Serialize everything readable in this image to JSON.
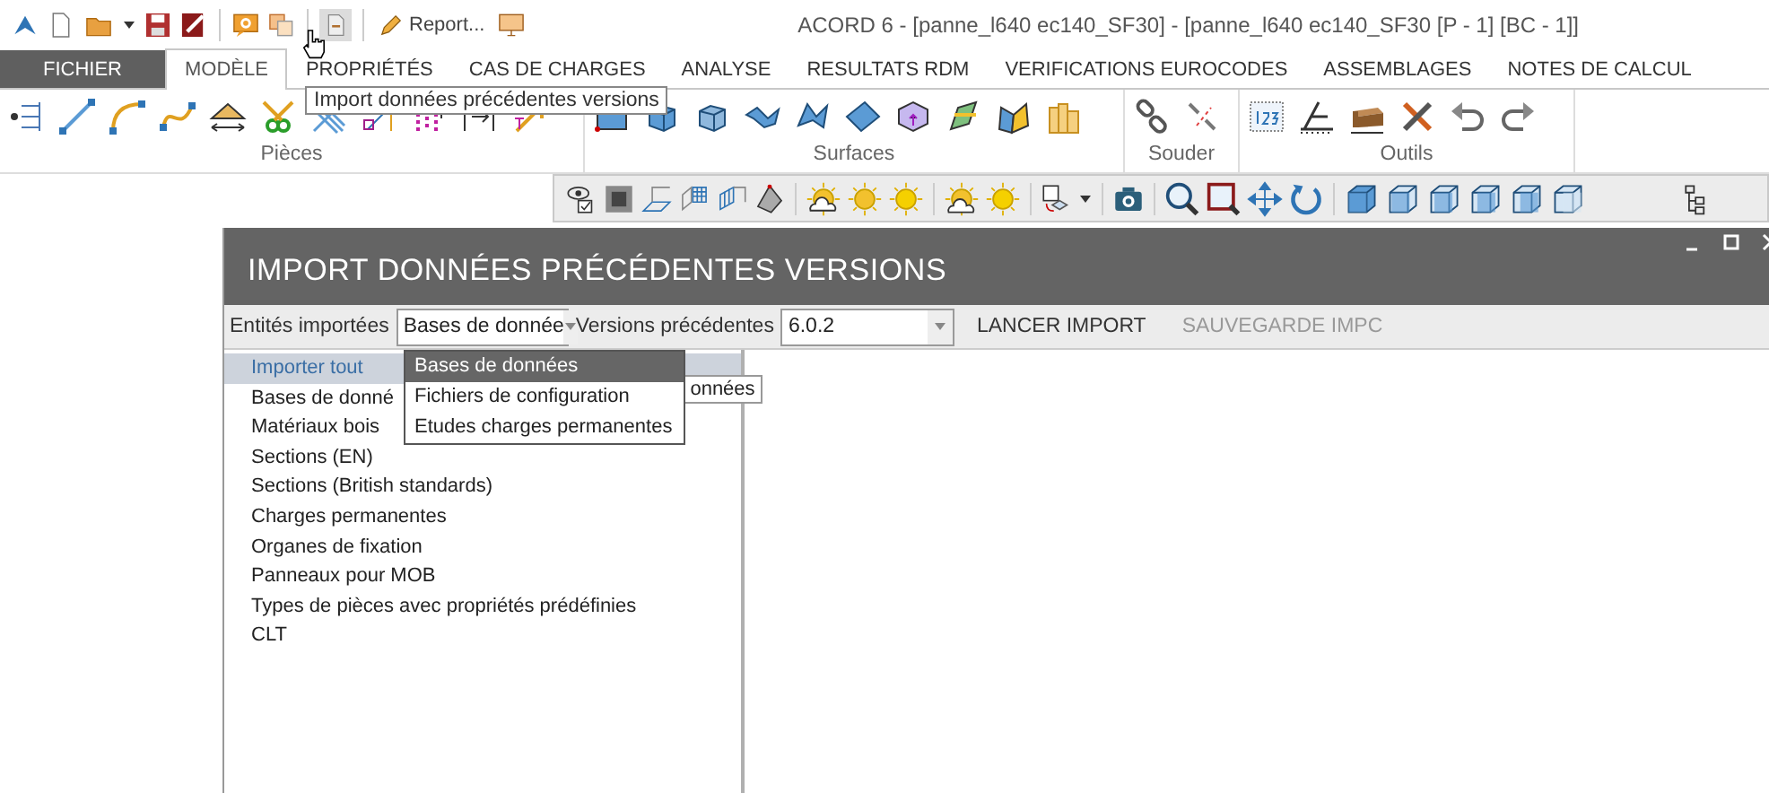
{
  "window": {
    "title": "ACORD 6 - [panne_l640 ec140_SF30] - [panne_l640 ec140_SF30 [P - 1] [BC - 1]]"
  },
  "quick_access": {
    "report_label": "Report..."
  },
  "tooltip": "Import données précédentes versions",
  "tabs": [
    {
      "label": "FICHIER",
      "kind": "file",
      "selected": false
    },
    {
      "label": "MODÈLE",
      "kind": "tab",
      "selected": true
    },
    {
      "label": "PROPRIÉTÉS",
      "kind": "tab",
      "selected": false
    },
    {
      "label": "CAS DE CHARGES",
      "kind": "tab",
      "selected": false
    },
    {
      "label": "ANALYSE",
      "kind": "tab",
      "selected": false
    },
    {
      "label": "RESULTATS RDM",
      "kind": "tab",
      "selected": false
    },
    {
      "label": "VERIFICATIONS EUROCODES",
      "kind": "tab",
      "selected": false
    },
    {
      "label": "ASSEMBLAGES",
      "kind": "tab",
      "selected": false
    },
    {
      "label": "NOTES DE CALCUL",
      "kind": "tab",
      "selected": false
    }
  ],
  "ribbon_groups": [
    {
      "label": "Pièces"
    },
    {
      "label": "Surfaces"
    },
    {
      "label": "Souder"
    },
    {
      "label": "Outils"
    }
  ],
  "dialog": {
    "title": "IMPORT DONNÉES PRÉCÉDENTES VERSIONS",
    "entities_label": "Entités importées",
    "entities_value": "Bases de donnée",
    "versions_label": "Versions précédentes",
    "versions_value": "6.0.2",
    "actions": [
      {
        "label": "LANCER IMPORT",
        "disabled": false
      },
      {
        "label": "SAUVEGARDE IMPC",
        "disabled": true
      }
    ],
    "items": [
      {
        "label": "Importer tout",
        "selected": true
      },
      {
        "label": "Bases de donné",
        "selected": false
      },
      {
        "label": "Matériaux bois",
        "selected": false
      },
      {
        "label": "Sections (EN)",
        "selected": false
      },
      {
        "label": "Sections (British standards)",
        "selected": false
      },
      {
        "label": "Charges permanentes",
        "selected": false
      },
      {
        "label": "Organes de fixation",
        "selected": false
      },
      {
        "label": "Panneaux pour MOB",
        "selected": false
      },
      {
        "label": "Types de pièces avec propriétés prédéfinies",
        "selected": false
      },
      {
        "label": "CLT",
        "selected": false
      }
    ],
    "dropdown": [
      {
        "label": "Bases de données",
        "selected": true
      },
      {
        "label": "Fichiers de configuration",
        "selected": false
      },
      {
        "label": "Etudes charges permanentes",
        "selected": false
      }
    ],
    "hint": "onnées"
  }
}
